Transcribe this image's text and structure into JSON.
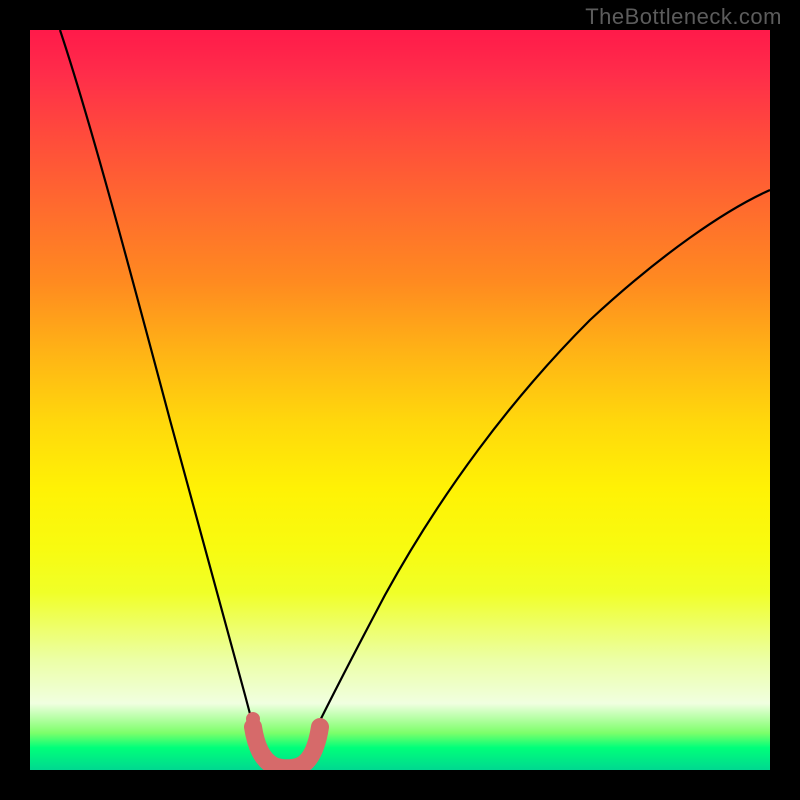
{
  "watermark": "TheBottleneck.com",
  "chart_data": {
    "type": "line",
    "title": "",
    "xlabel": "",
    "ylabel": "",
    "xlim": [
      0,
      100
    ],
    "ylim": [
      0,
      100
    ],
    "grid": false,
    "background": "rainbow-gradient (red at top through yellow to green at bottom) — color encodes vertical bottleneck severity",
    "series": [
      {
        "name": "left-curve",
        "description": "Steep descending curve from upper-left into the valley floor",
        "x": [
          4,
          7,
          10,
          13,
          16,
          19,
          22,
          25,
          27,
          29,
          30.5,
          32
        ],
        "y": [
          100,
          90,
          78,
          65,
          53,
          41,
          30,
          20,
          12,
          6,
          2,
          0
        ]
      },
      {
        "name": "right-curve",
        "description": "Rising curve from the valley floor toward the upper-right",
        "x": [
          36,
          38,
          41,
          45,
          50,
          56,
          63,
          71,
          80,
          90,
          100
        ],
        "y": [
          0,
          3,
          8,
          15,
          24,
          33,
          43,
          53,
          62,
          71,
          78
        ]
      },
      {
        "name": "valley-marker",
        "description": "Thick salmon U-shaped marker highlighting the optimal (minimum-bottleneck) region at the valley floor",
        "x": [
          30,
          30.5,
          31.5,
          33,
          34.5,
          36,
          37,
          37.5
        ],
        "y": [
          6,
          3,
          0.5,
          0,
          0,
          0.5,
          3,
          6
        ],
        "stroke": "#d66a6a",
        "stroke_width_px": 18
      }
    ],
    "annotations": [
      {
        "type": "dot",
        "x": 30.2,
        "y": 6.8,
        "color": "#d66a6a",
        "note": "small salmon dot at top-left of valley marker"
      }
    ]
  }
}
